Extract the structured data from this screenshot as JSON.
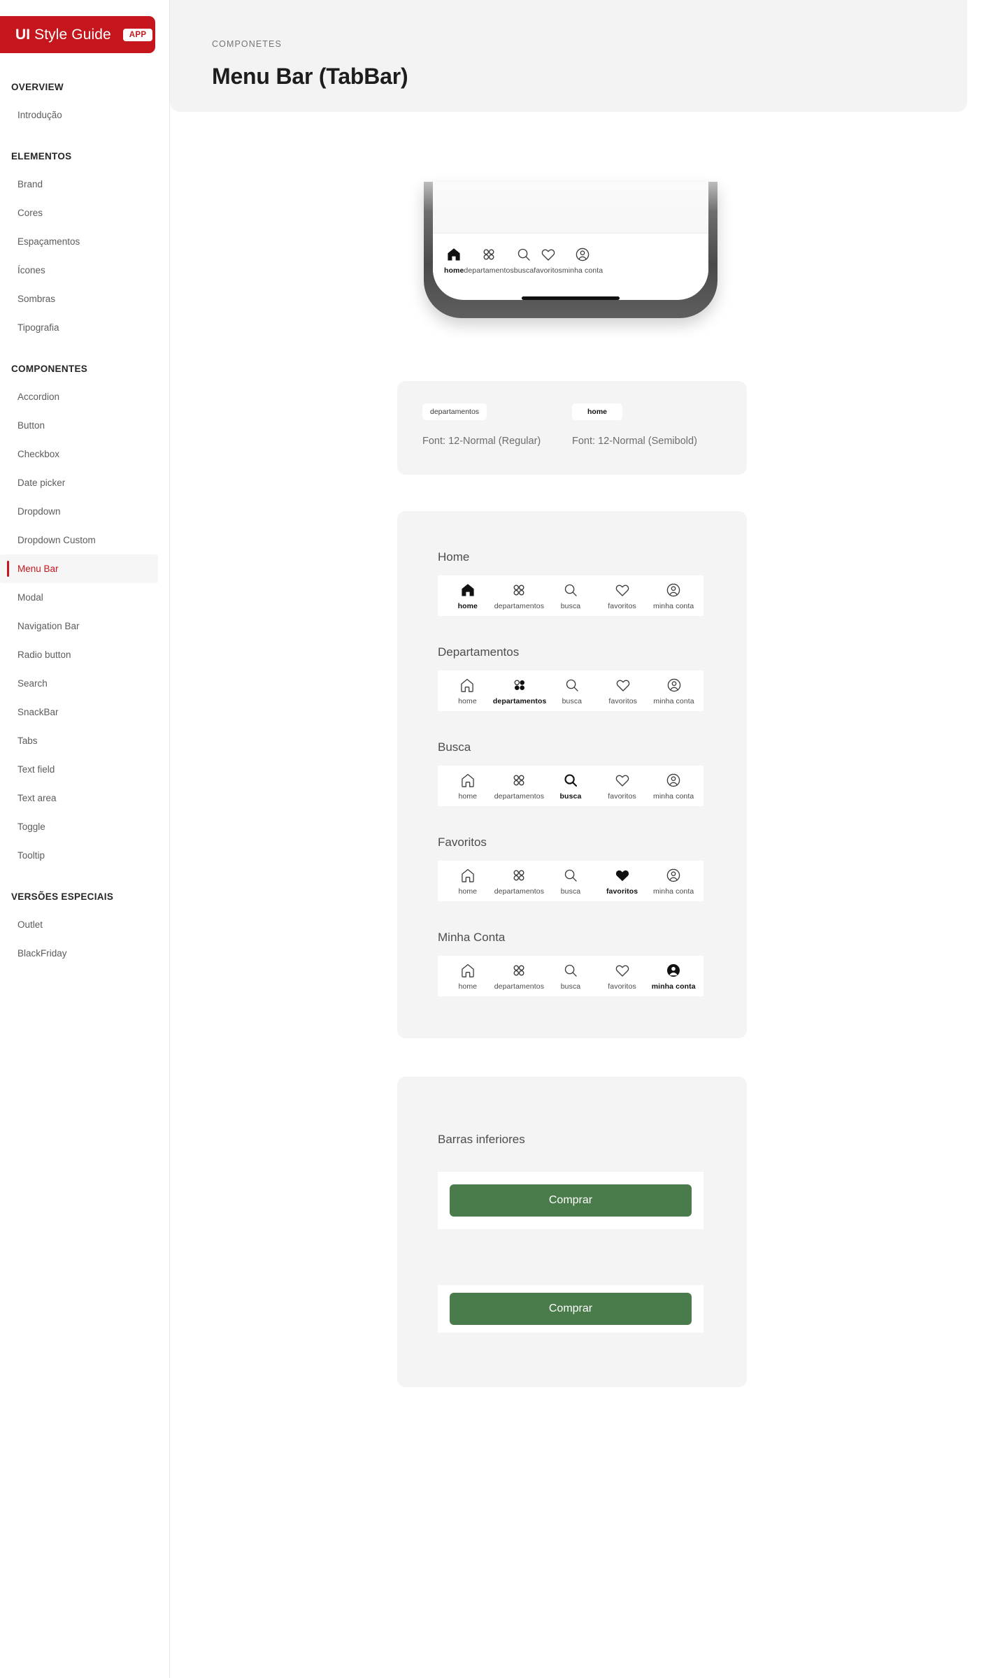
{
  "brand": {
    "title_bold": "UI",
    "title_light": " Style Guide",
    "badge": "APP"
  },
  "sidebar": {
    "groups": [
      {
        "title": "OVERVIEW",
        "items": [
          {
            "label": "Introdução",
            "active": false
          }
        ]
      },
      {
        "title": "ELEMENTOS",
        "items": [
          {
            "label": "Brand",
            "active": false
          },
          {
            "label": "Cores",
            "active": false
          },
          {
            "label": "Espaçamentos",
            "active": false
          },
          {
            "label": "Ícones",
            "active": false
          },
          {
            "label": "Sombras",
            "active": false
          },
          {
            "label": "Tipografia",
            "active": false
          }
        ]
      },
      {
        "title": "COMPONENTES",
        "items": [
          {
            "label": "Accordion",
            "active": false
          },
          {
            "label": "Button",
            "active": false
          },
          {
            "label": "Checkbox",
            "active": false
          },
          {
            "label": "Date picker",
            "active": false
          },
          {
            "label": "Dropdown",
            "active": false
          },
          {
            "label": "Dropdown Custom",
            "active": false
          },
          {
            "label": "Menu Bar",
            "active": true
          },
          {
            "label": "Modal",
            "active": false
          },
          {
            "label": "Navigation Bar",
            "active": false
          },
          {
            "label": "Radio button",
            "active": false
          },
          {
            "label": "Search",
            "active": false
          },
          {
            "label": "SnackBar",
            "active": false
          },
          {
            "label": "Tabs",
            "active": false
          },
          {
            "label": "Text field",
            "active": false
          },
          {
            "label": "Text area",
            "active": false
          },
          {
            "label": "Toggle",
            "active": false
          },
          {
            "label": "Tooltip",
            "active": false
          }
        ]
      },
      {
        "title": "VERSÕES ESPECIAIS",
        "items": [
          {
            "label": "Outlet",
            "active": false
          },
          {
            "label": "BlackFriday",
            "active": false
          }
        ]
      }
    ]
  },
  "header": {
    "breadcrumb": "COMPONETES",
    "title": "Menu Bar (TabBar)"
  },
  "tabs": [
    {
      "key": "home",
      "label": "home",
      "icon": "home-icon"
    },
    {
      "key": "departamentos",
      "label": "departamentos",
      "icon": "grid-icon"
    },
    {
      "key": "busca",
      "label": "busca",
      "icon": "search-icon"
    },
    {
      "key": "favoritos",
      "label": "favoritos",
      "icon": "heart-icon"
    },
    {
      "key": "minha-conta",
      "label": "minha conta",
      "icon": "user-icon"
    }
  ],
  "font_spec": {
    "regular": {
      "chip": "departamentos",
      "note": "Font: 12-Normal (Regular)"
    },
    "semibold": {
      "chip": "home",
      "note": "Font: 12-Normal (Semibold)"
    }
  },
  "states": [
    {
      "title": "Home",
      "active": "home"
    },
    {
      "title": "Departamentos",
      "active": "departamentos"
    },
    {
      "title": "Busca",
      "active": "busca"
    },
    {
      "title": "Favoritos",
      "active": "favoritos"
    },
    {
      "title": "Minha Conta",
      "active": "minha-conta"
    }
  ],
  "bottom_bars": {
    "title": "Barras inferiores",
    "button_label": "Comprar",
    "button_color": "#4a7b4a"
  },
  "colors": {
    "brand_red": "#C4161C",
    "active_text": "#111111",
    "inactive_text": "#4a4a4a",
    "card_bg": "#f4f4f4",
    "header_bg": "#f3f3f3"
  }
}
